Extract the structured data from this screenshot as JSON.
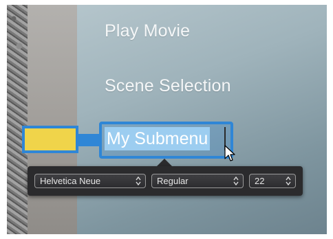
{
  "menu": {
    "items": [
      {
        "label": "Play Movie"
      },
      {
        "label": "Scene Selection"
      }
    ],
    "editing_item": {
      "label": "My Submenu"
    }
  },
  "text_toolbar": {
    "font_family": {
      "value": "Helvetica Neue"
    },
    "font_style": {
      "value": "Regular"
    },
    "font_size": {
      "value": "22"
    }
  },
  "colors": {
    "selection_accent": "#2f86d6",
    "placeholder_block": "#f0d44a",
    "toolbar_bg": "#2b2b2d"
  },
  "icons": {
    "popup_arrows": "up-down-chevron-icon",
    "cursor": "arrow-cursor-icon"
  }
}
